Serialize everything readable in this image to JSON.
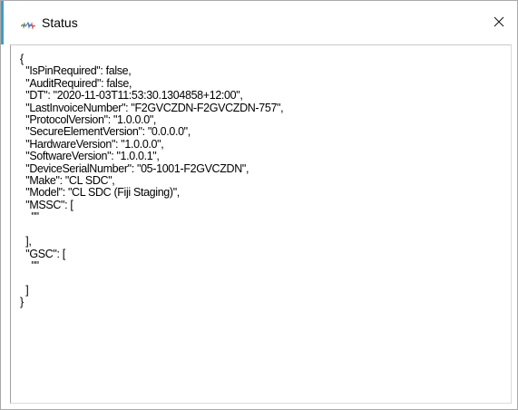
{
  "window": {
    "title": "Status",
    "icon": "status-app-icon",
    "close_icon": "close-icon",
    "accent_color": "#3c9ec8"
  },
  "json_output": {
    "lines": [
      "{",
      "  \"IsPinRequired\": false,",
      "  \"AuditRequired\": false,",
      "  \"DT\": \"2020-11-03T11:53:30.1304858+12:00\",",
      "  \"LastInvoiceNumber\": \"F2GVCZDN-F2GVCZDN-757\",",
      "  \"ProtocolVersion\": \"1.0.0.0\",",
      "  \"SecureElementVersion\": \"0.0.0.0\",",
      "  \"HardwareVersion\": \"1.0.0.0\",",
      "  \"SoftwareVersion\": \"1.0.0.1\",",
      "  \"DeviceSerialNumber\": \"05-1001-F2GVCZDN\",",
      "  \"Make\": \"CL SDC\",",
      "  \"Model\": \"CL SDC (Fiji Staging)\",",
      "  \"MSSC\": [",
      "    \"\"",
      "",
      "  ],",
      "  \"GSC\": [",
      "    \"\"",
      "",
      "  ]",
      "}"
    ]
  }
}
